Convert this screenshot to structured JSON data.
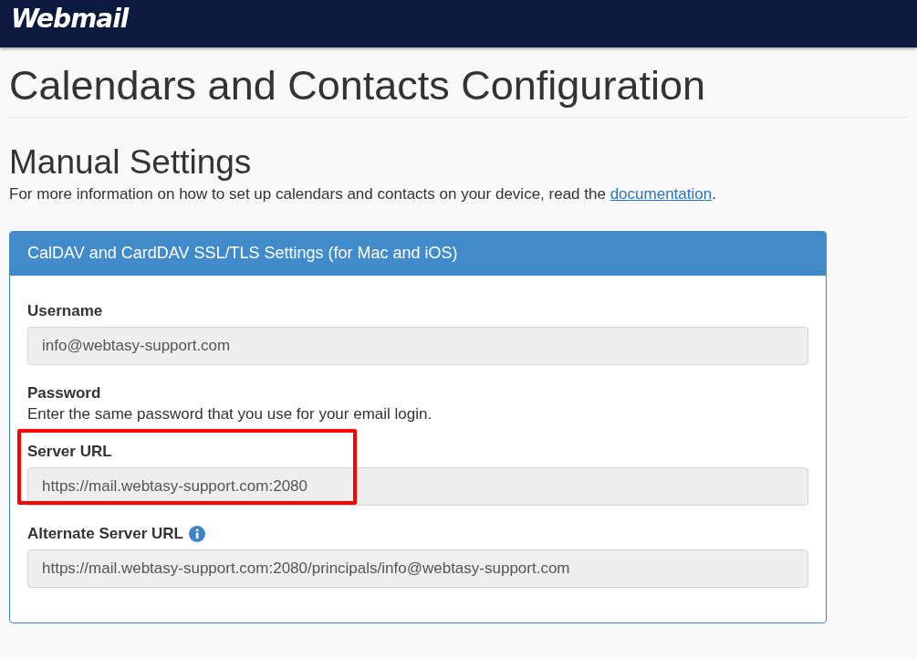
{
  "header": {
    "logo": "Webmail"
  },
  "page_title": "Calendars and Contacts Configuration",
  "section": {
    "title": "Manual Settings",
    "intro": "For more information on how to set up calendars and contacts on your device, read the ",
    "link": "documentation",
    "intro_end": "."
  },
  "panel": {
    "title": "CalDAV and CardDAV SSL/TLS Settings (for Mac and iOS)",
    "fields": [
      {
        "kind": "input",
        "label": "Username",
        "value": "info@webtasy-support.com",
        "info_icon": false,
        "highlighted": false
      },
      {
        "kind": "note",
        "label": "Password",
        "help": "Enter the same password that you use for your email login.",
        "info_icon": false,
        "highlighted": false
      },
      {
        "kind": "input",
        "label": "Server URL",
        "value": "https://mail.webtasy-support.com:2080",
        "info_icon": false,
        "highlighted": true
      },
      {
        "kind": "input",
        "label": "Alternate Server URL",
        "value": "https://mail.webtasy-support.com:2080/principals/info@webtasy-support.com",
        "info_icon": true,
        "highlighted": false
      }
    ]
  }
}
